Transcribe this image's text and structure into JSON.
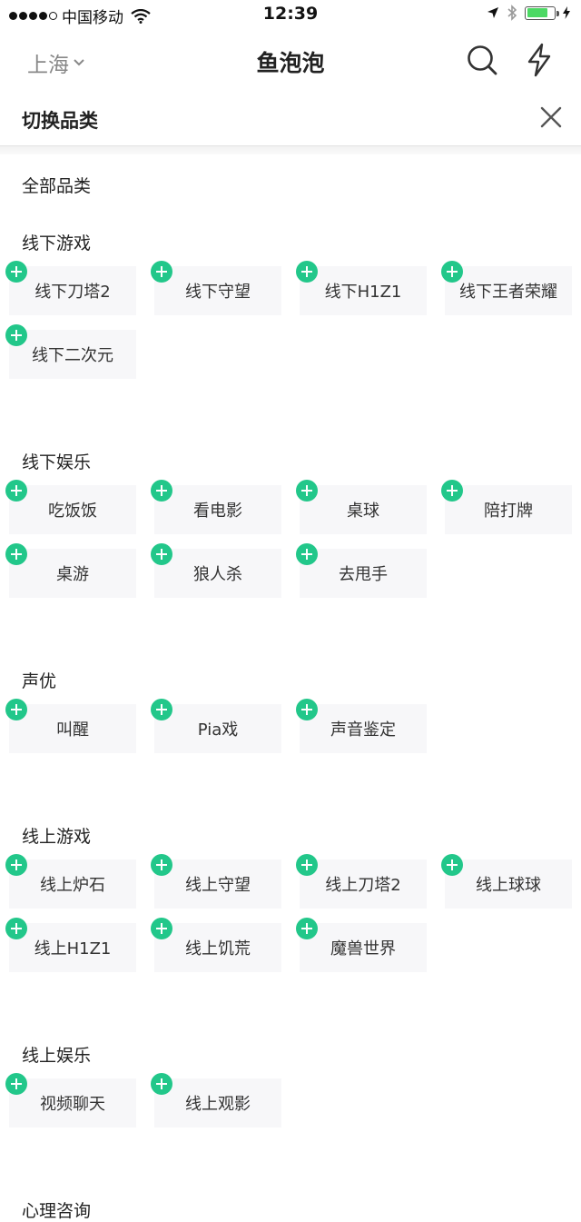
{
  "status_bar": {
    "carrier": "中国移动",
    "time": "12:39"
  },
  "nav": {
    "city": "上海",
    "title": "鱼泡泡"
  },
  "panel": {
    "title": "切换品类",
    "all_label": "全部品类"
  },
  "sections": [
    {
      "title": "线下游戏",
      "items": [
        "线下刀塔2",
        "线下守望",
        "线下H1Z1",
        "线下王者荣耀",
        "线下二次元"
      ]
    },
    {
      "title": "线下娱乐",
      "items": [
        "吃饭饭",
        "看电影",
        "桌球",
        "陪打牌",
        "桌游",
        "狼人杀",
        "去甩手"
      ]
    },
    {
      "title": "声优",
      "items": [
        "叫醒",
        "Pia戏",
        "声音鉴定"
      ]
    },
    {
      "title": "线上游戏",
      "items": [
        "线上炉石",
        "线上守望",
        "线上刀塔2",
        "线上球球",
        "线上H1Z1",
        "线上饥荒",
        "魔兽世界"
      ]
    },
    {
      "title": "线上娱乐",
      "items": [
        "视频聊天",
        "线上观影"
      ]
    },
    {
      "title": "心理咨询",
      "items": []
    }
  ],
  "colors": {
    "accent": "#22c78a",
    "chip_bg": "#f7f7f9",
    "battery": "#4cd964"
  },
  "icons": [
    "signal-dots-icon",
    "wifi-icon",
    "location-arrow-icon",
    "bluetooth-icon",
    "battery-icon",
    "chevron-down-icon",
    "search-icon",
    "lightning-icon",
    "close-icon",
    "plus-icon"
  ]
}
